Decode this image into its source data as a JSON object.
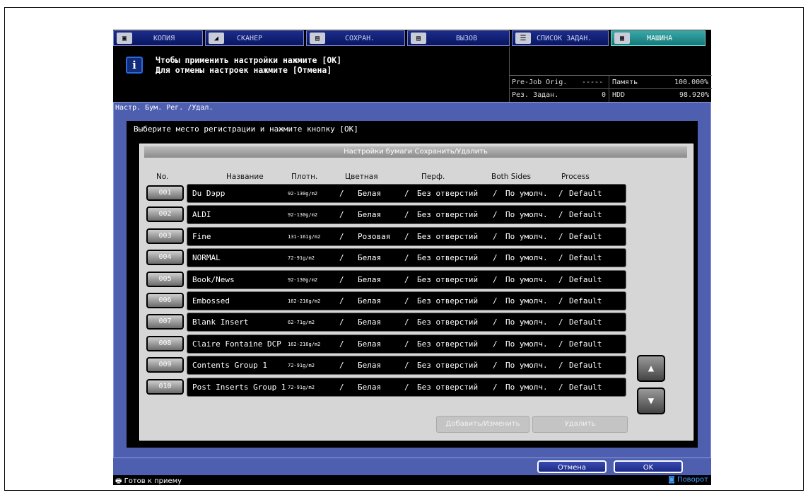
{
  "tabs": [
    {
      "label": "КОПИЯ",
      "icon": "copy-icon",
      "glyph": "▣"
    },
    {
      "label": "СКАНЕР",
      "icon": "scanner-icon",
      "glyph": "◢"
    },
    {
      "label": "СОХРАН.",
      "icon": "save-icon",
      "glyph": "▤"
    },
    {
      "label": "ВЫЗОВ",
      "icon": "recall-icon",
      "glyph": "▤"
    },
    {
      "label": "СПИСОК ЗАДАН.",
      "icon": "job-list-icon",
      "glyph": "☰"
    },
    {
      "label": "МАШИНА",
      "icon": "machine-icon",
      "glyph": "▦"
    }
  ],
  "info": {
    "icon": "info-icon",
    "line1": "Чтобы применить настройки нажмите [OK]",
    "line2": "Для отмены настроек нажмите [Отмена]"
  },
  "status": {
    "prejob_label": "Pre-Job Orig.",
    "prejob_value": "-----",
    "res_label": "Рез. Задан.",
    "res_value": "0",
    "memory_label": "Память",
    "memory_value": "100.000%",
    "hdd_label": "HDD",
    "hdd_value": "98.920%"
  },
  "dialog": {
    "title": "Настр. Бум. Рег. /Удал.",
    "instruction": "Выберите место регистрации и нажмите кнопку [OK]",
    "panel_title": "Настройки бумаги Сохранить/Удалить",
    "columns": {
      "no": "No.",
      "name": "Название",
      "weight": "Плотн.",
      "color": "Цветная",
      "punch": "Перф.",
      "both": "Both Sides",
      "process": "Process"
    },
    "rows": [
      {
        "no": "001",
        "name": "Du Dэрр",
        "weight": "92-130g/m2",
        "color": "Белая",
        "punch": "Без отверстий",
        "both": "По умолч.",
        "process": "Default"
      },
      {
        "no": "002",
        "name": "ALDI",
        "weight": "92-130g/m2",
        "color": "Белая",
        "punch": "Без отверстий",
        "both": "По умолч.",
        "process": "Default"
      },
      {
        "no": "003",
        "name": "Fine",
        "weight": "131-161g/m2",
        "color": "Розовая",
        "punch": "Без отверстий",
        "both": "По умолч.",
        "process": "Default"
      },
      {
        "no": "004",
        "name": "NORMAL",
        "weight": "72-91g/m2",
        "color": "Белая",
        "punch": "Без отверстий",
        "both": "По умолч.",
        "process": "Default"
      },
      {
        "no": "005",
        "name": "Book/News",
        "weight": "92-130g/m2",
        "color": "Белая",
        "punch": "Без отверстий",
        "both": "По умолч.",
        "process": "Default"
      },
      {
        "no": "006",
        "name": "Embossed",
        "weight": "162-216g/m2",
        "color": "Белая",
        "punch": "Без отверстий",
        "both": "По умолч.",
        "process": "Default"
      },
      {
        "no": "007",
        "name": "Blank Insert",
        "weight": "62-71g/m2",
        "color": "Белая",
        "punch": "Без отверстий",
        "both": "По умолч.",
        "process": "Default"
      },
      {
        "no": "008",
        "name": "Claire Fontaine DCP",
        "weight": "162-216g/m2",
        "color": "Белая",
        "punch": "Без отверстий",
        "both": "По умолч.",
        "process": "Default"
      },
      {
        "no": "009",
        "name": "Contents Group 1",
        "weight": "72-91g/m2",
        "color": "Белая",
        "punch": "Без отверстий",
        "both": "По умолч.",
        "process": "Default"
      },
      {
        "no": "010",
        "name": "Post Inserts Group 1",
        "weight": "72-91g/m2",
        "color": "Белая",
        "punch": "Без отверстий",
        "both": "По умолч.",
        "process": "Default"
      }
    ],
    "add_edit_label": "Добавить/Изменить",
    "delete_label": "Удалить",
    "scroll_up": "▲",
    "scroll_down": "▼",
    "cancel_label": "Отмена",
    "ok_label": "OK"
  },
  "footer": {
    "ready_icon": "printer-icon",
    "ready": "Готов к приему",
    "rotate_icon": "rotate-icon",
    "rotate": "Поворот"
  },
  "colors": {
    "accent": "#4f5fb0",
    "active_tab": "#1f8f8f",
    "info_blue": "#2a6adf"
  }
}
